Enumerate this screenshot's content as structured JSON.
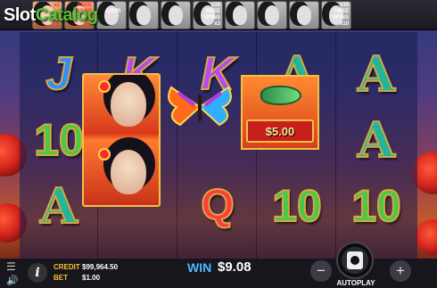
{
  "logo": {
    "part1": "Slot",
    "part2": "Catalog",
    "suffix": "com"
  },
  "history": [
    {
      "colored": true,
      "tag": "x2"
    },
    {
      "colored": true,
      "tag": "FREE SPINS x2"
    },
    {
      "colored": false,
      "tag": ""
    },
    {
      "colored": false,
      "tag": ""
    },
    {
      "colored": false,
      "tag": ""
    },
    {
      "colored": false,
      "tag": "x10 FREE SPINS x3"
    },
    {
      "colored": false,
      "tag": ""
    },
    {
      "colored": false,
      "tag": ""
    },
    {
      "colored": false,
      "tag": ""
    },
    {
      "colored": false,
      "tag": "x10 FREE SPINS x10"
    }
  ],
  "reels": {
    "r1": [
      "J",
      "10",
      "A"
    ],
    "r2": [
      "K",
      "",
      ""
    ],
    "r3": [
      "K",
      "",
      "Q"
    ],
    "r4": [
      "A",
      "",
      "10"
    ],
    "r5": [
      "A",
      "A",
      "10"
    ]
  },
  "bonus": {
    "value": "$5.00"
  },
  "bar": {
    "credit_label": "CREDIT",
    "credit_value": "$99,964.50",
    "bet_label": "BET",
    "bet_value": "$1.00",
    "win_label": "WIN",
    "win_value": "$9.08",
    "minus": "−",
    "plus": "+",
    "autoplay": "AUTOPLAY"
  },
  "colors": {
    "win_label": "#4fb8ff",
    "credit_label": "#f6c232"
  }
}
